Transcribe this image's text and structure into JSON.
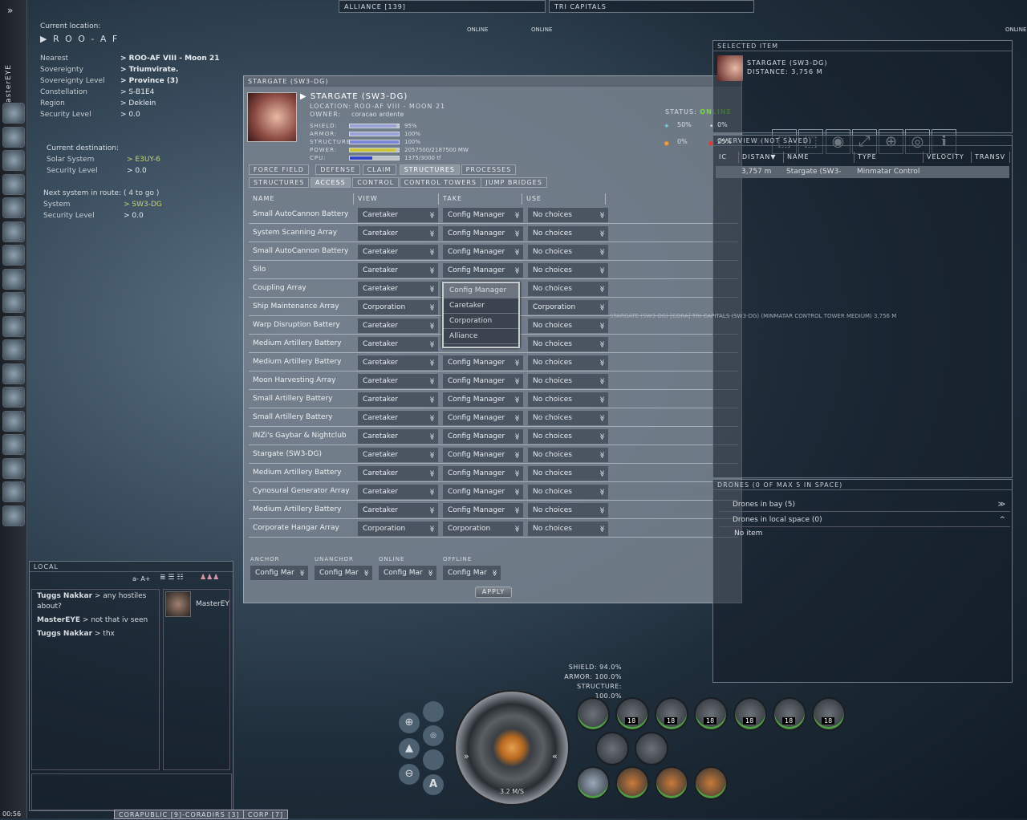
{
  "pilot": "MasterEYE",
  "location": {
    "label": "Current location:",
    "system": "R O O - A F",
    "rows": [
      {
        "k": "Nearest",
        "v": "ROO-AF VIII - Moon 21",
        "bold": true
      },
      {
        "k": "Sovereignty",
        "v": "Triumvirate.",
        "bold": true
      },
      {
        "k": "Sovereignty Level",
        "v": "Province (3)",
        "bold": true
      },
      {
        "k": "Constellation",
        "v": "S-B1E4"
      },
      {
        "k": "Region",
        "v": "Deklein"
      },
      {
        "k": "Security Level",
        "v": "0.0"
      }
    ],
    "destination": {
      "label": "Current destination:",
      "rows": [
        {
          "k": "Solar System",
          "v": "E3UY-6"
        },
        {
          "k": "Security Level",
          "v": "0.0"
        }
      ]
    },
    "route": {
      "label": "Next system in route: ( 4 to go )",
      "rows": [
        {
          "k": "System",
          "v": "SW3-DG"
        },
        {
          "k": "Security Level",
          "v": "0.0"
        }
      ]
    }
  },
  "topbar": {
    "alliance": "ALLIANCE [139]",
    "channel": "TRI CAPITALS",
    "online1": "ONLINE",
    "online2": "ONLINE",
    "online_right": "ONLINE"
  },
  "window": {
    "title": "STARGATE (SW3-DG)",
    "name": "STARGATE (SW3-DG)",
    "location_label": "LOCATION:",
    "location": "ROO-AF VIII - MOON 21",
    "owner_label": "OWNER:",
    "owner": "coracao ardente",
    "stats": [
      {
        "k": "SHIELD:",
        "v": "95%",
        "pct": 95,
        "color": "#9aa3d8"
      },
      {
        "k": "ARMOR:",
        "v": "100%",
        "pct": 100,
        "color": "#9aa3d8"
      },
      {
        "k": "STRUCTURE:",
        "v": "100%",
        "pct": 100,
        "color": "#7a86d6"
      },
      {
        "k": "POWER:",
        "v": "2057500/2187500 MW",
        "pct": 94,
        "color": "#c9c43a"
      },
      {
        "k": "CPU:",
        "v": "1375/3000 tf",
        "pct": 46,
        "color": "#3344c8"
      }
    ],
    "status_label": "STATUS:",
    "status": "ONLINE",
    "status_color": "#6fe03a",
    "resists": [
      "50%",
      "0%",
      "0%",
      "25%"
    ],
    "tabs1": [
      "FORCE FIELD",
      "DEFENSE",
      "CLAIM",
      "STRUCTURES",
      "PROCESSES"
    ],
    "tabs1_active": "STRUCTURES",
    "tabs2": [
      "STRUCTURES",
      "ACCESS",
      "CONTROL",
      "CONTROL TOWERS",
      "JUMP BRIDGES"
    ],
    "tabs2_active": "ACCESS",
    "columns": [
      "NAME",
      "VIEW",
      "TAKE",
      "USE"
    ],
    "rows": [
      [
        "Small AutoCannon Battery",
        "Caretaker",
        "Config Manager",
        "No choices"
      ],
      [
        "System Scanning Array",
        "Caretaker",
        "Config Manager",
        "No choices"
      ],
      [
        "Small AutoCannon Battery",
        "Caretaker",
        "Config Manager",
        "No choices"
      ],
      [
        "Silo",
        "Caretaker",
        "Config Manager",
        "No choices"
      ],
      [
        "Coupling Array",
        "Caretaker",
        "",
        "No choices"
      ],
      [
        "Ship Maintenance Array",
        "Corporation",
        "",
        "Corporation"
      ],
      [
        "Warp Disruption Battery",
        "Caretaker",
        "",
        "No choices"
      ],
      [
        "Medium Artillery Battery",
        "Caretaker",
        "",
        "No choices"
      ],
      [
        "Medium Artillery Battery",
        "Caretaker",
        "Config Manager",
        "No choices"
      ],
      [
        "Moon Harvesting Array",
        "Caretaker",
        "Config Manager",
        "No choices"
      ],
      [
        "Small Artillery Battery",
        "Caretaker",
        "Config Manager",
        "No choices"
      ],
      [
        "Small Artillery Battery",
        "Caretaker",
        "Config Manager",
        "No choices"
      ],
      [
        "INZi's Gaybar & Nightclub",
        "Caretaker",
        "Config Manager",
        "No choices"
      ],
      [
        "Stargate (SW3-DG)",
        "Caretaker",
        "Config Manager",
        "No choices"
      ],
      [
        "Medium Artillery Battery",
        "Caretaker",
        "Config Manager",
        "No choices"
      ],
      [
        "Cynosural Generator Array",
        "Caretaker",
        "Config Manager",
        "No choices"
      ],
      [
        "Medium Artillery Battery",
        "Caretaker",
        "Config Manager",
        "No choices"
      ],
      [
        "Corporate Hangar Array",
        "Corporation",
        "Corporation",
        "No choices"
      ]
    ],
    "dropdown": [
      "Config Manager",
      "Caretaker",
      "Corporation",
      "Alliance"
    ],
    "footer": [
      {
        "k": "ANCHOR",
        "v": "Config Mar"
      },
      {
        "k": "UNANCHOR",
        "v": "Config Mar"
      },
      {
        "k": "ONLINE",
        "v": "Config Mar"
      },
      {
        "k": "OFFLINE",
        "v": "Config Mar"
      }
    ],
    "apply": "APPLY"
  },
  "selected": {
    "title": "SELECTED ITEM",
    "name": "STARGATE (SW3-DG)",
    "distance": "DISTANCE: 3,756 M"
  },
  "overview": {
    "title": "OVERVIEW (NOT SAVED)",
    "columns": [
      "IC",
      "DISTAN▼",
      "NAME",
      "TYPE",
      "VELOCITY",
      "TRANSV"
    ],
    "row": [
      "3,757 m",
      "Stargate (SW3-",
      "Minmatar Control"
    ]
  },
  "drones": {
    "title": "DRONES (0 OF MAX 5 IN SPACE)",
    "bay": "Drones in bay (5)",
    "local": "Drones in local space (0)",
    "empty": "No item"
  },
  "space_label": "STARGATE (SW3-DG) [CORA] TRI-CAPITALS (SW3-DG) (MINMATAR CONTROL TOWER MEDIUM) 3,756 M",
  "chat": {
    "title": "LOCAL",
    "font_controls": "a- A+",
    "messages": [
      {
        "who": "Tuggs Nakkar",
        "text": "any hostiles about?"
      },
      {
        "who": "MasterEYE",
        "text": "not that iv seen"
      },
      {
        "who": "Tuggs Nakkar",
        "text": "thx"
      }
    ],
    "member": "MasterEY",
    "tabs": [
      "CORAPUBLIC [9]-CORADIRS [3]",
      "CORP [7]"
    ]
  },
  "clock": "00:56",
  "hud": {
    "shield": "SHIELD: 94.0%",
    "armor": "ARMOR: 100.0%",
    "structure": "STRUCTURE: 100.0%",
    "speed": "3.2 M/S",
    "ammo": "18"
  }
}
